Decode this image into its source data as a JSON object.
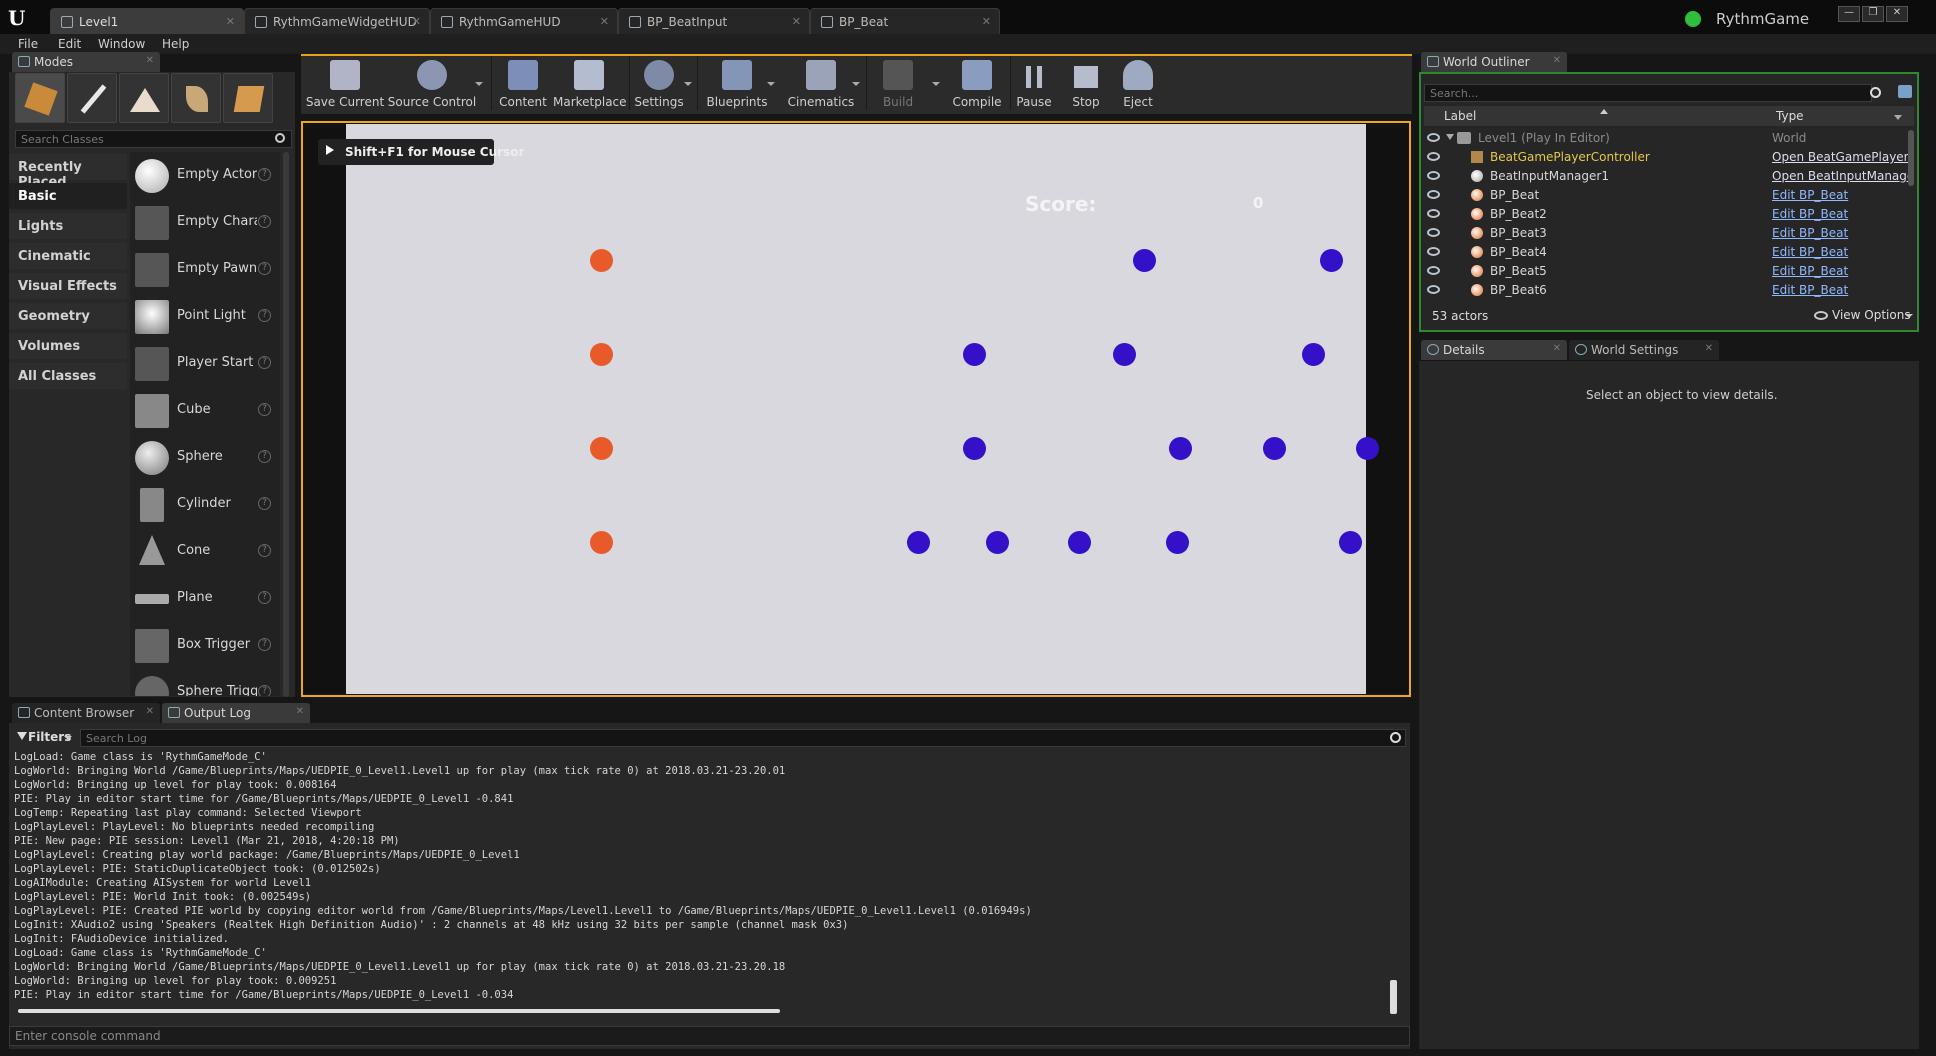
{
  "window": {
    "app_name": "RythmGame",
    "tabs": [
      {
        "label": "Level1",
        "active": true
      },
      {
        "label": "RythmGameWidgetHUD"
      },
      {
        "label": "RythmGameHUD"
      },
      {
        "label": "BP_BeatInput"
      },
      {
        "label": "BP_Beat"
      }
    ],
    "menu": [
      "File",
      "Edit",
      "Window",
      "Help"
    ],
    "controls": {
      "minimize": "—",
      "maximize": "❐",
      "close": "✕"
    }
  },
  "modes": {
    "tab_label": "Modes",
    "search_placeholder": "Search Classes",
    "categories": [
      "Recently Placed",
      "Basic",
      "Lights",
      "Cinematic",
      "Visual Effects",
      "Geometry",
      "Volumes",
      "All Classes"
    ],
    "selected_category": "Basic",
    "items": [
      "Empty Actor",
      "Empty Character",
      "Empty Pawn",
      "Point Light",
      "Player Start",
      "Cube",
      "Sphere",
      "Cylinder",
      "Cone",
      "Plane",
      "Box Trigger",
      "Sphere Trigger"
    ],
    "help_glyph": "?"
  },
  "toolbar": {
    "buttons": [
      "Save Current",
      "Source Control",
      "Content",
      "Marketplace",
      "Settings",
      "Blueprints",
      "Cinematics",
      "Build",
      "Compile",
      "Pause",
      "Stop",
      "Eject"
    ]
  },
  "viewport": {
    "hint": "Shift+F1 for Mouse Cursor",
    "score_label": "Score:",
    "score_value": "0",
    "colors": {
      "background": "#d8d8de",
      "target": "#e85a2a",
      "beat": "#3410c8",
      "border": "#f0a81a"
    }
  },
  "outliner": {
    "tab_label": "World Outliner",
    "search_placeholder": "Search...",
    "col_label": "Label",
    "col_type": "Type",
    "rows": [
      {
        "label": "Level1 (Play In Editor)",
        "type": "World"
      },
      {
        "label": "BeatGamePlayerController",
        "type": "Open BeatGamePlayerController"
      },
      {
        "label": "BeatInputManager1",
        "type": "Open BeatInputManager"
      },
      {
        "label": "BP_Beat",
        "type": "Edit BP_Beat"
      },
      {
        "label": "BP_Beat2",
        "type": "Edit BP_Beat"
      },
      {
        "label": "BP_Beat3",
        "type": "Edit BP_Beat"
      },
      {
        "label": "BP_Beat4",
        "type": "Edit BP_Beat"
      },
      {
        "label": "BP_Beat5",
        "type": "Edit BP_Beat"
      },
      {
        "label": "BP_Beat6",
        "type": "Edit BP_Beat"
      }
    ],
    "actor_count": "53 actors",
    "view_options": "View Options"
  },
  "details": {
    "tab_details": "Details",
    "tab_world_settings": "World Settings",
    "empty_message": "Select an object to view details."
  },
  "bottom": {
    "tab_content_browser": "Content Browser",
    "tab_output_log": "Output Log",
    "filters": "Filters",
    "search_placeholder": "Search Log",
    "console_placeholder": "Enter console command",
    "log_lines": [
      "LogLoad: Game class is 'RythmGameMode_C'",
      "LogWorld: Bringing World /Game/Blueprints/Maps/UEDPIE_0_Level1.Level1 up for play (max tick rate 0) at 2018.03.21-23.20.01",
      "LogWorld: Bringing up level for play took: 0.008164",
      "PIE: Play in editor start time for /Game/Blueprints/Maps/UEDPIE_0_Level1 -0.841",
      "LogTemp: Repeating last play command: Selected Viewport",
      "LogPlayLevel: PlayLevel: No blueprints needed recompiling",
      "PIE: New page: PIE session: Level1 (Mar 21, 2018, 4:20:18 PM)",
      "LogPlayLevel: Creating play world package: /Game/Blueprints/Maps/UEDPIE_0_Level1",
      "LogPlayLevel: PIE: StaticDuplicateObject took: (0.012502s)",
      "LogAIModule: Creating AISystem for world Level1",
      "LogPlayLevel: PIE: World Init took: (0.002549s)",
      "LogPlayLevel: PIE: Created PIE world by copying editor world from /Game/Blueprints/Maps/Level1.Level1 to /Game/Blueprints/Maps/UEDPIE_0_Level1.Level1 (0.016949s)",
      "LogInit: XAudio2 using 'Speakers (Realtek High Definition Audio)' : 2 channels at 48 kHz using 32 bits per sample (channel mask 0x3)",
      "LogInit: FAudioDevice initialized.",
      "LogLoad: Game class is 'RythmGameMode_C'",
      "LogWorld: Bringing World /Game/Blueprints/Maps/UEDPIE_0_Level1.Level1 up for play (max tick rate 0) at 2018.03.21-23.20.18",
      "LogWorld: Bringing up level for play took: 0.009251",
      "PIE: Play in editor start time for /Game/Blueprints/Maps/UEDPIE_0_Level1 -0.034"
    ]
  }
}
